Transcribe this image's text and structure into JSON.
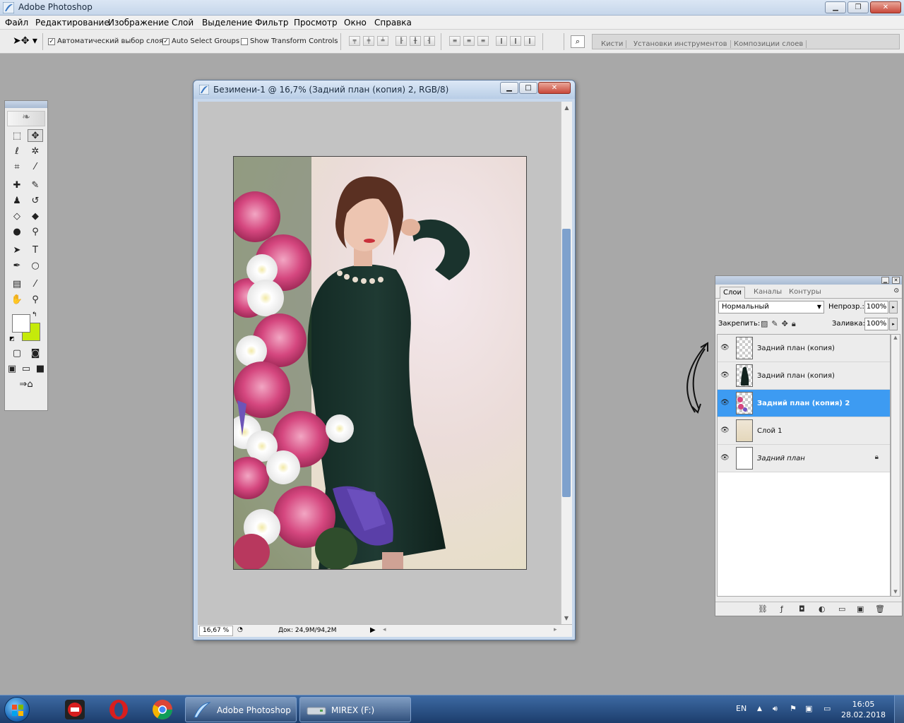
{
  "window": {
    "title": "Adobe Photoshop",
    "controls": [
      "0",
      "1",
      "r"
    ]
  },
  "menu": [
    "Файл",
    "Редактирование",
    "Изображение",
    "Слой",
    "Выделение",
    "Фильтр",
    "Просмотр",
    "Окно",
    "Справка"
  ],
  "options": {
    "auto_select_layer": "Автоматический выбор слоя",
    "auto_select_groups": "Auto Select Groups",
    "show_transform": "Show Transform Controls",
    "auto_select_layer_checked": true,
    "auto_select_groups_checked": true,
    "show_transform_checked": false
  },
  "palette_well": [
    "Кисти",
    "Установки инструментов",
    "Композиции слоев"
  ],
  "tools": {
    "foreground_color": "#ffffff",
    "background_color": "#c5ea0a"
  },
  "document": {
    "title": "Безимени-1 @ 16,7% (Задний план (копия) 2, RGB/8)",
    "zoom": "16,67 %",
    "doc_info": "Док: 24,9M/94,2M"
  },
  "layers_panel": {
    "tabs": [
      "Слои",
      "Каналы",
      "Контуры"
    ],
    "blend_mode": "Нормальный",
    "opacity_label": "Непрозр.:",
    "opacity_value": "100%",
    "lock_label": "Закрепить:",
    "fill_label": "Заливка:",
    "fill_value": "100%",
    "layers": [
      {
        "name": "Задний план (копия)",
        "thumb": "checker",
        "selected": false,
        "visible": true
      },
      {
        "name": "Задний план (копия)",
        "thumb": "figure",
        "selected": false,
        "visible": true
      },
      {
        "name": "Задний план (копия) 2",
        "thumb": "checker",
        "selected": true,
        "visible": true
      },
      {
        "name": "Слой 1",
        "thumb": "paper",
        "selected": false,
        "visible": true
      },
      {
        "name": "Задний план",
        "thumb": "white",
        "selected": false,
        "visible": true,
        "locked": true
      }
    ]
  },
  "taskbar": {
    "apps": [
      {
        "label": "Adobe Photoshop"
      },
      {
        "label": "MIREX (F:)"
      }
    ],
    "language": "EN",
    "time": "16:05",
    "date": "28.02.2018"
  }
}
